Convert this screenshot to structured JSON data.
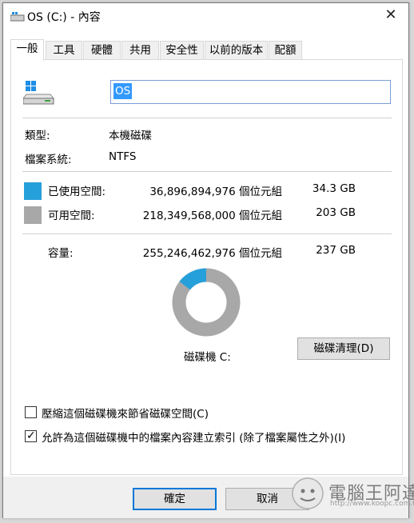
{
  "window": {
    "title": "OS (C:) - 內容",
    "close_glyph": "✕"
  },
  "tabs": [
    {
      "label": "一般",
      "active": true
    },
    {
      "label": "工具",
      "active": false
    },
    {
      "label": "硬體",
      "active": false
    },
    {
      "label": "共用",
      "active": false
    },
    {
      "label": "安全性",
      "active": false
    },
    {
      "label": "以前的版本",
      "active": false
    },
    {
      "label": "配額",
      "active": false
    }
  ],
  "drive": {
    "name_value": "OS",
    "icon": "windows-drive-icon"
  },
  "info": {
    "type_label": "類型:",
    "type_value": "本機磁碟",
    "fs_label": "檔案系統:",
    "fs_value": "NTFS"
  },
  "usage": {
    "used_label": "已使用空間:",
    "used_bytes": "36,896,894,976 個位元組",
    "used_size": "34.3 GB",
    "used_color": "#26a0da",
    "free_label": "可用空間:",
    "free_bytes": "218,349,568,000 個位元組",
    "free_size": "203 GB",
    "free_color": "#a8a8a8",
    "capacity_label": "容量:",
    "capacity_bytes": "255,246,462,976 個位元組",
    "capacity_size": "237 GB",
    "used_fraction": 0.1446
  },
  "disk_label": "磁碟機 C:",
  "cleanup_button": "磁碟清理(D)",
  "options": {
    "compress_label": "壓縮這個磁碟機來節省磁碟空間(C)",
    "compress_checked": false,
    "index_label": "允許為這個磁碟機中的檔案內容建立索引 (除了檔案屬性之外)(I)",
    "index_checked": true
  },
  "buttons": {
    "ok": "確定",
    "cancel": "取消"
  },
  "watermark": {
    "text": "電腦王阿達",
    "url": "http://www.koopc.com.tw"
  }
}
